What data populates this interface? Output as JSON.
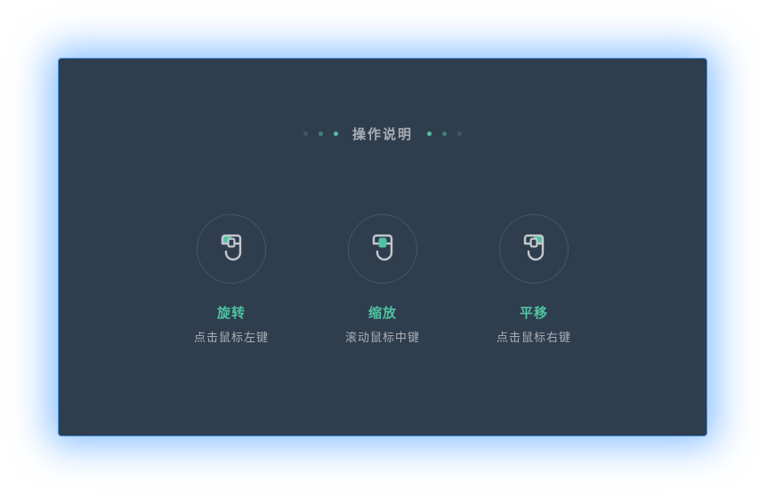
{
  "dialog": {
    "title": "操作说明",
    "accent_color": "#4fc3a1",
    "items": [
      {
        "icon": "mouse-left-button-icon",
        "label": "旋转",
        "desc": "点击鼠标左键",
        "highlight": "left"
      },
      {
        "icon": "mouse-scroll-wheel-icon",
        "label": "缩放",
        "desc": "滚动鼠标中键",
        "highlight": "middle"
      },
      {
        "icon": "mouse-right-button-icon",
        "label": "平移",
        "desc": "点击鼠标右键",
        "highlight": "right"
      }
    ]
  }
}
